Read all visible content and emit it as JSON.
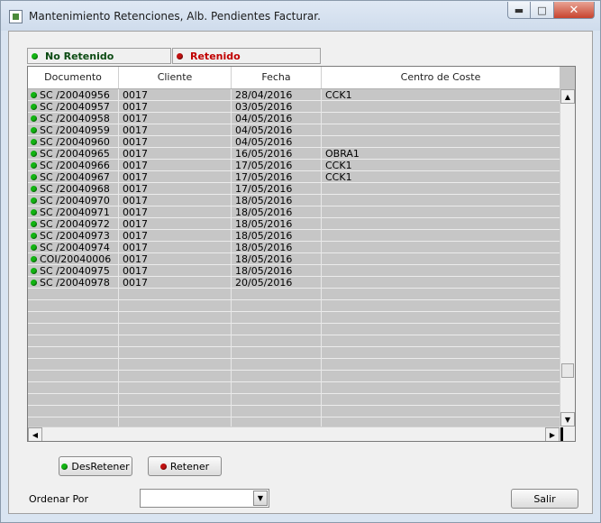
{
  "window": {
    "title": "Mantenimiento Retenciones, Alb. Pendientes Facturar.",
    "minimize_glyph": "▬",
    "maximize_glyph": "□",
    "close_glyph": "✕"
  },
  "legend": {
    "no_retenido": "No Retenido",
    "retenido": "Retenido",
    "green": "#12b412",
    "red": "#c01010"
  },
  "grid": {
    "columns": [
      "Documento",
      "Cliente",
      "Fecha",
      "Centro de Coste"
    ],
    "rows": [
      {
        "documento": "SC /20040956",
        "cliente": "0017",
        "fecha": "28/04/2016",
        "centro": "CCK1"
      },
      {
        "documento": "SC /20040957",
        "cliente": "0017",
        "fecha": "03/05/2016",
        "centro": ""
      },
      {
        "documento": "SC /20040958",
        "cliente": "0017",
        "fecha": "04/05/2016",
        "centro": ""
      },
      {
        "documento": "SC /20040959",
        "cliente": "0017",
        "fecha": "04/05/2016",
        "centro": ""
      },
      {
        "documento": "SC /20040960",
        "cliente": "0017",
        "fecha": "04/05/2016",
        "centro": ""
      },
      {
        "documento": "SC /20040965",
        "cliente": "0017",
        "fecha": "16/05/2016",
        "centro": "OBRA1"
      },
      {
        "documento": "SC /20040966",
        "cliente": "0017",
        "fecha": "17/05/2016",
        "centro": "CCK1"
      },
      {
        "documento": "SC /20040967",
        "cliente": "0017",
        "fecha": "17/05/2016",
        "centro": "CCK1"
      },
      {
        "documento": "SC /20040968",
        "cliente": "0017",
        "fecha": "17/05/2016",
        "centro": ""
      },
      {
        "documento": "SC /20040970",
        "cliente": "0017",
        "fecha": "18/05/2016",
        "centro": ""
      },
      {
        "documento": "SC /20040971",
        "cliente": "0017",
        "fecha": "18/05/2016",
        "centro": ""
      },
      {
        "documento": "SC /20040972",
        "cliente": "0017",
        "fecha": "18/05/2016",
        "centro": ""
      },
      {
        "documento": "SC /20040973",
        "cliente": "0017",
        "fecha": "18/05/2016",
        "centro": ""
      },
      {
        "documento": "SC /20040974",
        "cliente": "0017",
        "fecha": "18/05/2016",
        "centro": ""
      },
      {
        "documento": "COI/20040006",
        "cliente": "0017",
        "fecha": "18/05/2016",
        "centro": ""
      },
      {
        "documento": "SC /20040975",
        "cliente": "0017",
        "fecha": "18/05/2016",
        "centro": ""
      },
      {
        "documento": "SC /20040978",
        "cliente": "0017",
        "fecha": "20/05/2016",
        "centro": ""
      }
    ]
  },
  "buttons": {
    "desretener": "DesRetener",
    "retener": "Retener",
    "salir": "Salir"
  },
  "ordenar": {
    "label": "Ordenar Por",
    "value": ""
  },
  "scroll": {
    "up": "▲",
    "down": "▼",
    "left": "◀",
    "right": "▶"
  }
}
